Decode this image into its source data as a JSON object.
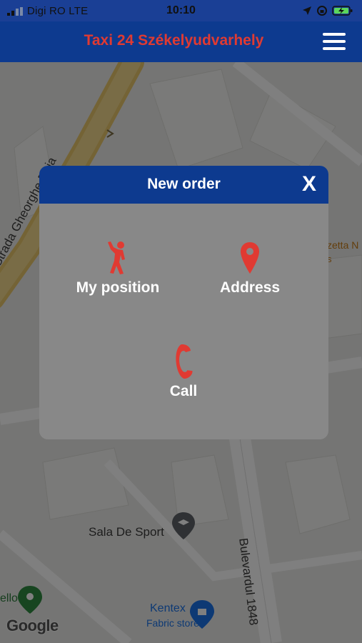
{
  "status_bar": {
    "carrier": "Digi RO  LTE",
    "time": "10:10"
  },
  "app_bar": {
    "title": "Taxi 24 Székelyudvarhely"
  },
  "map": {
    "road_labels": [
      "Strada Gheorghe Doja",
      "Bulevardul 1848"
    ],
    "poi_labels": {
      "sala": "Sala De Sport",
      "kentex": "Kentex",
      "kentex_sub": "Fabric store",
      "pizzeria": "zetta N",
      "pizzeria_sub": "s",
      "hello": "ello"
    },
    "logo": "Google"
  },
  "dialog": {
    "title": "New order",
    "close_label": "X",
    "options": {
      "my_position": "My position",
      "address": "Address",
      "call": "Call"
    }
  },
  "colors": {
    "brand_blue": "#0d3a8f",
    "accent_red": "#e03a32",
    "dialog_body": "#888888",
    "map_road_yellow": "#e8c66a"
  },
  "icons": {
    "my_position": "person-hailing-icon",
    "address": "map-pin-icon",
    "call": "phone-handset-icon",
    "menu": "hamburger-menu-icon"
  }
}
